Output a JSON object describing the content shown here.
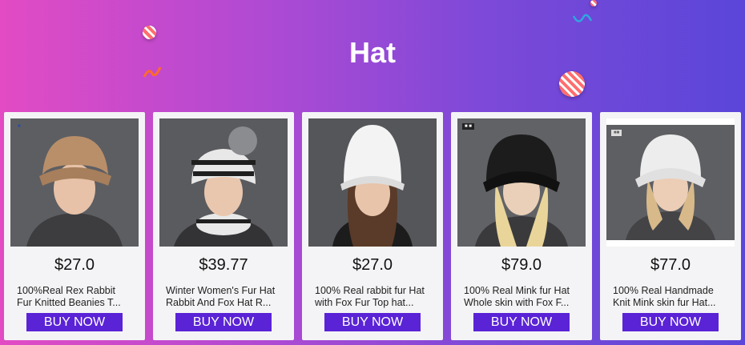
{
  "banner": {
    "title": "Hat",
    "colors": {
      "gradient_start": "#e24bc4",
      "gradient_end": "#5a46d9",
      "button": "#5a23d6"
    }
  },
  "products": [
    {
      "price": "$27.0",
      "name_line1": "100%Real Rex Rabbit",
      "name_line2": "Fur Knitted Beanies T...",
      "button": "BUY NOW",
      "hat_color": "#b98f6a",
      "bg": "#5d5e62"
    },
    {
      "price": "$39.77",
      "name_line1": "Winter Women's Fur Hat",
      "name_line2": "Rabbit And Fox Hat R...",
      "button": "BUY NOW",
      "hat_color": "#e8e8e8",
      "bg": "#5a5b5f"
    },
    {
      "price": "$27.0",
      "name_line1": "100% Real rabbit fur Hat",
      "name_line2": "with Fox Fur Top hat...",
      "button": "BUY NOW",
      "hat_color": "#f3f3f3",
      "bg": "#55565a"
    },
    {
      "price": "$79.0",
      "name_line1": "100% Real Mink fur Hat",
      "name_line2": "Whole skin with Fox F...",
      "button": "BUY NOW",
      "hat_color": "#1c1c1c",
      "bg": "#616266"
    },
    {
      "price": "$77.0",
      "name_line1": "100% Real Handmade",
      "name_line2": "Knit Mink skin fur Hat...",
      "button": "BUY NOW",
      "hat_color": "#ededed",
      "bg": "#5e5f63"
    }
  ]
}
